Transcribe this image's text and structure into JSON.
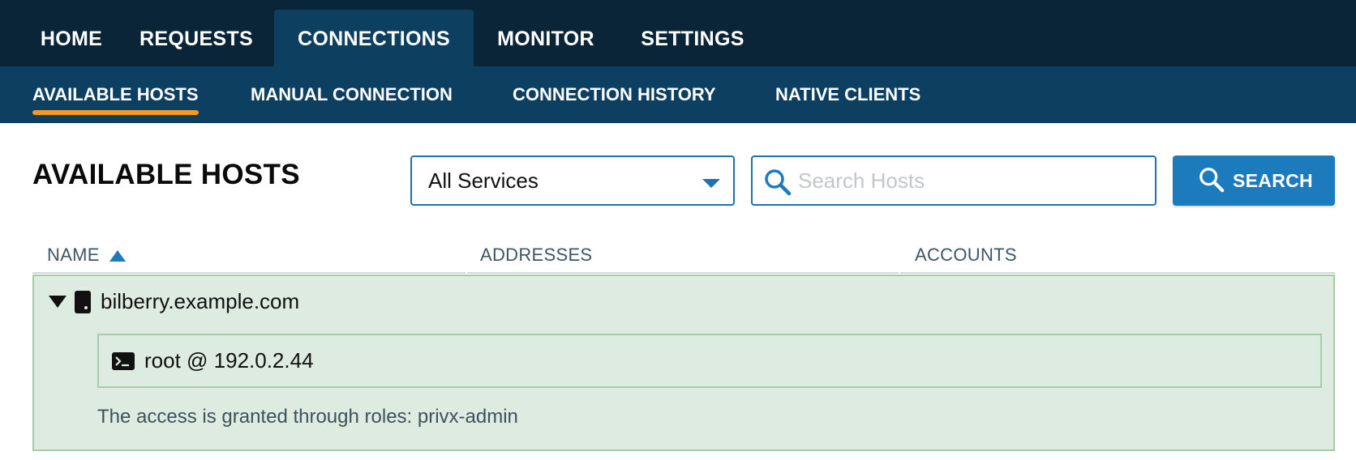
{
  "top_nav": {
    "tabs": [
      {
        "label": "HOME",
        "active": false
      },
      {
        "label": "REQUESTS",
        "active": false
      },
      {
        "label": "CONNECTIONS",
        "active": true
      },
      {
        "label": "MONITOR",
        "active": false
      },
      {
        "label": "SETTINGS",
        "active": false
      }
    ]
  },
  "sub_nav": {
    "tabs": [
      {
        "label": "AVAILABLE HOSTS",
        "active": true
      },
      {
        "label": "MANUAL CONNECTION",
        "active": false
      },
      {
        "label": "CONNECTION HISTORY",
        "active": false
      },
      {
        "label": "NATIVE CLIENTS",
        "active": false
      }
    ]
  },
  "page": {
    "title": "AVAILABLE HOSTS"
  },
  "filter": {
    "service_select": {
      "selected": "All Services",
      "icon": "chevron-down-icon"
    },
    "search": {
      "placeholder": "Search Hosts",
      "value": "",
      "icon": "search-icon"
    },
    "search_button": {
      "label": "SEARCH",
      "icon": "search-icon"
    }
  },
  "table": {
    "columns": [
      {
        "label": "NAME",
        "sort": "ascending"
      },
      {
        "label": "ADDRESSES"
      },
      {
        "label": "ACCOUNTS"
      }
    ],
    "hosts": [
      {
        "name": "bilberry.example.com",
        "expanded": true,
        "icon": "server-icon",
        "accounts": [
          {
            "label": "root @ 192.0.2.44",
            "icon": "terminal-icon"
          }
        ],
        "roles_note": "The access is granted through roles: privx-admin"
      }
    ]
  },
  "colors": {
    "top_nav_bg": "#0b2538",
    "sub_nav_bg": "#0d3f61",
    "active_underline": "#f39a1e",
    "accent": "#1c7bbd",
    "host_panel_bg": "#deebe0",
    "host_panel_border": "#a2cfa6"
  }
}
